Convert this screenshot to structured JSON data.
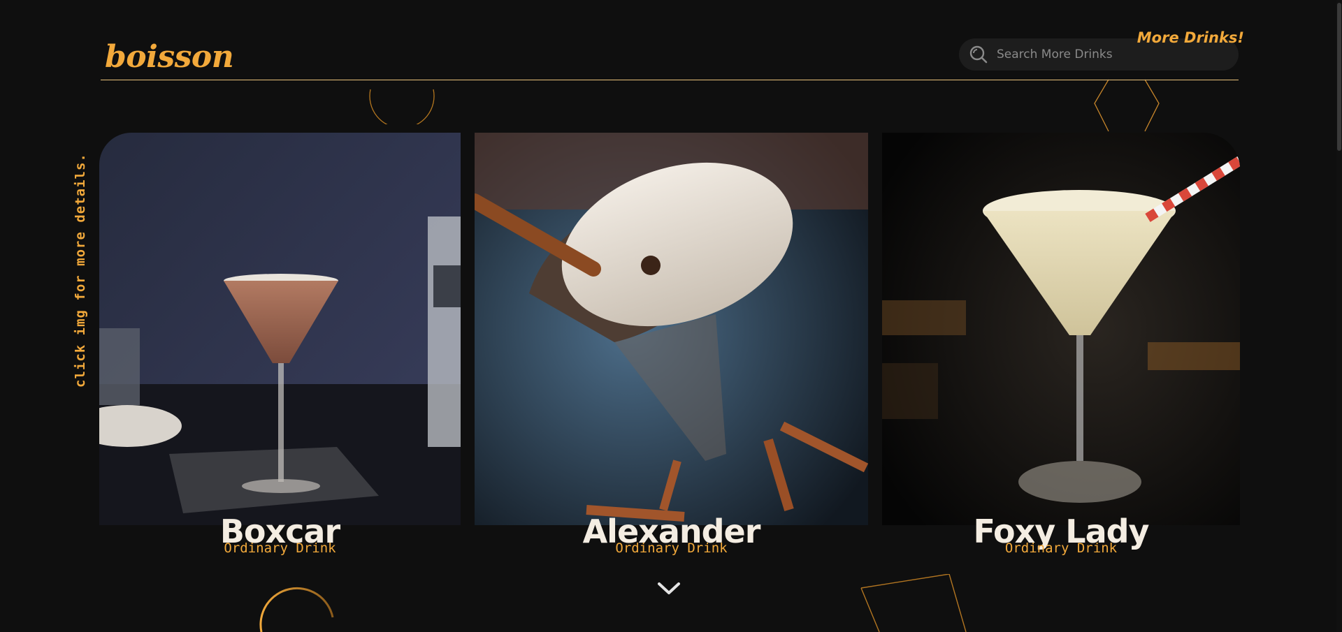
{
  "brand": {
    "logo": "boisson"
  },
  "search": {
    "placeholder": "Search More Drinks",
    "value": ""
  },
  "nav": {
    "more_drinks": "More Drinks!"
  },
  "hint": "click img for more details.",
  "drinks": [
    {
      "name": "Boxcar",
      "category": "Ordinary Drink"
    },
    {
      "name": "Alexander",
      "category": "Ordinary Drink"
    },
    {
      "name": "Foxy Lady",
      "category": "Ordinary Drink"
    }
  ],
  "colors": {
    "accent": "#f2a93b",
    "background": "#0f0f0f",
    "divider": "#e9c27a",
    "title": "#f4ede2"
  },
  "icons": {
    "search": "search-icon",
    "scroll": "chevron-down-icon"
  }
}
